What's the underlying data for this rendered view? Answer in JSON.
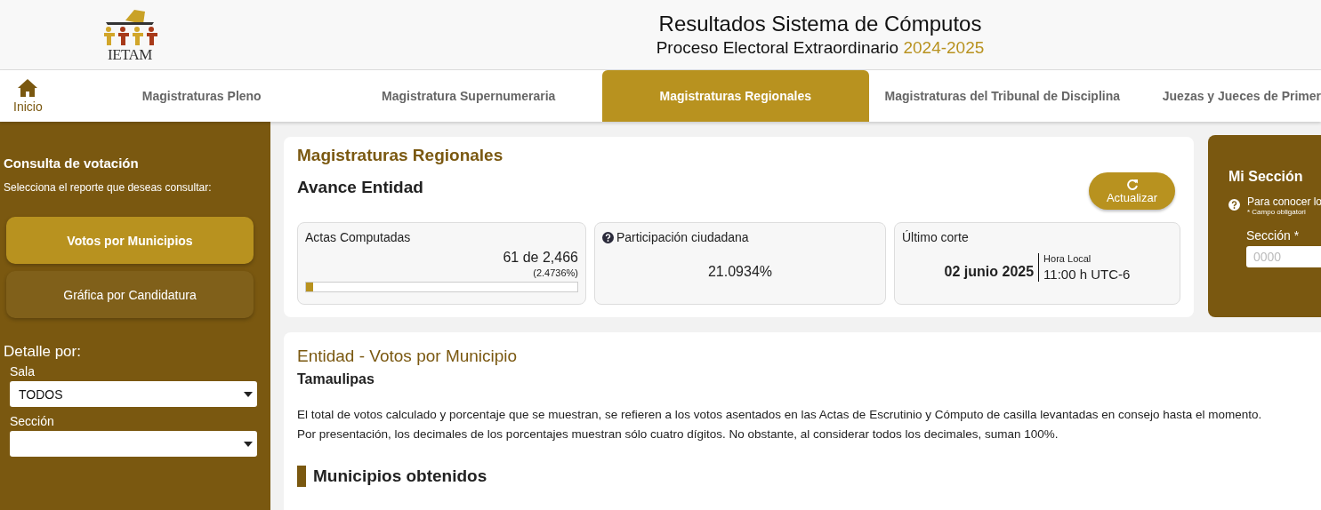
{
  "header": {
    "logo_text": "IETAM",
    "title": "Resultados Sistema de Cómputos",
    "subtitle": "Proceso Electoral Extraordinario",
    "year": "2024-2025"
  },
  "nav": {
    "home": "Inicio",
    "tabs": [
      {
        "label": "Magistraturas Pleno",
        "selected": false
      },
      {
        "label": "Magistratura Supernumeraria",
        "selected": false
      },
      {
        "label": "Magistraturas Regionales",
        "selected": true
      },
      {
        "label": "Magistraturas del Tribunal de Disciplina",
        "selected": false
      },
      {
        "label": "Juezas y Jueces de Primer",
        "selected": false
      }
    ]
  },
  "sidebar": {
    "title": "Consulta de votación",
    "hint": "Selecciona el reporte que deseas consultar:",
    "reports": [
      {
        "label": "Votos por Municipios",
        "selected": true
      },
      {
        "label": "Gráfica por Candidatura",
        "selected": false
      }
    ],
    "detail_title": "Detalle por:",
    "filters": [
      {
        "label": "Sala",
        "value": "TODOS"
      },
      {
        "label": "Sección"
      }
    ]
  },
  "summary": {
    "title": "Magistraturas Regionales",
    "subtitle": "Avance Entidad",
    "refresh": "Actualizar",
    "actas": {
      "label": "Actas Computadas",
      "count": "61 de 2,466",
      "percent": "(2.4736%)",
      "level": 0.0247
    },
    "participation": {
      "label": "Participación ciudadana",
      "value": "21.0934%"
    },
    "cutoff": {
      "label": "Último corte",
      "date": "02 junio 2025",
      "time_label": "Hora Local",
      "time": "11:00 h UTC-6"
    }
  },
  "mi_seccion": {
    "title": "Mi Sección",
    "text": "Para conocer lo",
    "note": "* Campo obligatori",
    "field_label": "Sección *",
    "placeholder": "0000"
  },
  "detail": {
    "title": "Entidad - Votos por Municipio",
    "entity": "Tamaulipas",
    "notes": [
      "El total de votos calculado y porcentaje que se muestran, se refieren a los votos asentados en las Actas de Escrutinio y Cómputo de casilla levantadas en consejo hasta el momento.",
      "Por presentación, los decimales de los porcentajes muestran sólo cuatro dígitos. No obstante, al considerar todos los decimales, suman 100%."
    ],
    "section_title": "Municipios obtenidos"
  }
}
